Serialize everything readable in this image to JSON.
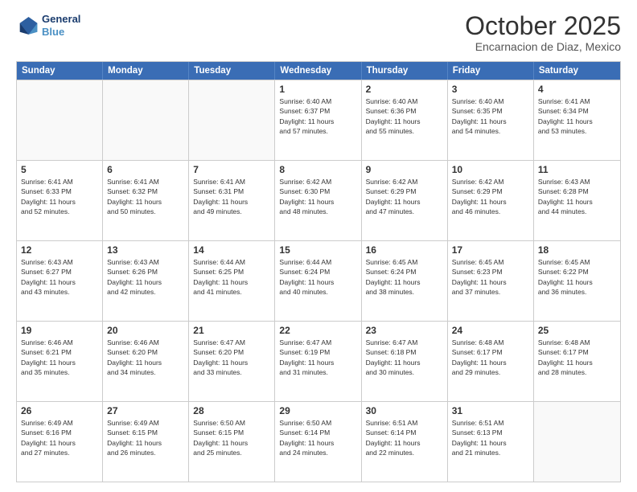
{
  "logo": {
    "line1": "General",
    "line2": "Blue"
  },
  "header": {
    "month": "October 2025",
    "location": "Encarnacion de Diaz, Mexico"
  },
  "days": [
    "Sunday",
    "Monday",
    "Tuesday",
    "Wednesday",
    "Thursday",
    "Friday",
    "Saturday"
  ],
  "weeks": [
    [
      {
        "day": "",
        "info": ""
      },
      {
        "day": "",
        "info": ""
      },
      {
        "day": "",
        "info": ""
      },
      {
        "day": "1",
        "info": "Sunrise: 6:40 AM\nSunset: 6:37 PM\nDaylight: 11 hours\nand 57 minutes."
      },
      {
        "day": "2",
        "info": "Sunrise: 6:40 AM\nSunset: 6:36 PM\nDaylight: 11 hours\nand 55 minutes."
      },
      {
        "day": "3",
        "info": "Sunrise: 6:40 AM\nSunset: 6:35 PM\nDaylight: 11 hours\nand 54 minutes."
      },
      {
        "day": "4",
        "info": "Sunrise: 6:41 AM\nSunset: 6:34 PM\nDaylight: 11 hours\nand 53 minutes."
      }
    ],
    [
      {
        "day": "5",
        "info": "Sunrise: 6:41 AM\nSunset: 6:33 PM\nDaylight: 11 hours\nand 52 minutes."
      },
      {
        "day": "6",
        "info": "Sunrise: 6:41 AM\nSunset: 6:32 PM\nDaylight: 11 hours\nand 50 minutes."
      },
      {
        "day": "7",
        "info": "Sunrise: 6:41 AM\nSunset: 6:31 PM\nDaylight: 11 hours\nand 49 minutes."
      },
      {
        "day": "8",
        "info": "Sunrise: 6:42 AM\nSunset: 6:30 PM\nDaylight: 11 hours\nand 48 minutes."
      },
      {
        "day": "9",
        "info": "Sunrise: 6:42 AM\nSunset: 6:29 PM\nDaylight: 11 hours\nand 47 minutes."
      },
      {
        "day": "10",
        "info": "Sunrise: 6:42 AM\nSunset: 6:29 PM\nDaylight: 11 hours\nand 46 minutes."
      },
      {
        "day": "11",
        "info": "Sunrise: 6:43 AM\nSunset: 6:28 PM\nDaylight: 11 hours\nand 44 minutes."
      }
    ],
    [
      {
        "day": "12",
        "info": "Sunrise: 6:43 AM\nSunset: 6:27 PM\nDaylight: 11 hours\nand 43 minutes."
      },
      {
        "day": "13",
        "info": "Sunrise: 6:43 AM\nSunset: 6:26 PM\nDaylight: 11 hours\nand 42 minutes."
      },
      {
        "day": "14",
        "info": "Sunrise: 6:44 AM\nSunset: 6:25 PM\nDaylight: 11 hours\nand 41 minutes."
      },
      {
        "day": "15",
        "info": "Sunrise: 6:44 AM\nSunset: 6:24 PM\nDaylight: 11 hours\nand 40 minutes."
      },
      {
        "day": "16",
        "info": "Sunrise: 6:45 AM\nSunset: 6:24 PM\nDaylight: 11 hours\nand 38 minutes."
      },
      {
        "day": "17",
        "info": "Sunrise: 6:45 AM\nSunset: 6:23 PM\nDaylight: 11 hours\nand 37 minutes."
      },
      {
        "day": "18",
        "info": "Sunrise: 6:45 AM\nSunset: 6:22 PM\nDaylight: 11 hours\nand 36 minutes."
      }
    ],
    [
      {
        "day": "19",
        "info": "Sunrise: 6:46 AM\nSunset: 6:21 PM\nDaylight: 11 hours\nand 35 minutes."
      },
      {
        "day": "20",
        "info": "Sunrise: 6:46 AM\nSunset: 6:20 PM\nDaylight: 11 hours\nand 34 minutes."
      },
      {
        "day": "21",
        "info": "Sunrise: 6:47 AM\nSunset: 6:20 PM\nDaylight: 11 hours\nand 33 minutes."
      },
      {
        "day": "22",
        "info": "Sunrise: 6:47 AM\nSunset: 6:19 PM\nDaylight: 11 hours\nand 31 minutes."
      },
      {
        "day": "23",
        "info": "Sunrise: 6:47 AM\nSunset: 6:18 PM\nDaylight: 11 hours\nand 30 minutes."
      },
      {
        "day": "24",
        "info": "Sunrise: 6:48 AM\nSunset: 6:17 PM\nDaylight: 11 hours\nand 29 minutes."
      },
      {
        "day": "25",
        "info": "Sunrise: 6:48 AM\nSunset: 6:17 PM\nDaylight: 11 hours\nand 28 minutes."
      }
    ],
    [
      {
        "day": "26",
        "info": "Sunrise: 6:49 AM\nSunset: 6:16 PM\nDaylight: 11 hours\nand 27 minutes."
      },
      {
        "day": "27",
        "info": "Sunrise: 6:49 AM\nSunset: 6:15 PM\nDaylight: 11 hours\nand 26 minutes."
      },
      {
        "day": "28",
        "info": "Sunrise: 6:50 AM\nSunset: 6:15 PM\nDaylight: 11 hours\nand 25 minutes."
      },
      {
        "day": "29",
        "info": "Sunrise: 6:50 AM\nSunset: 6:14 PM\nDaylight: 11 hours\nand 24 minutes."
      },
      {
        "day": "30",
        "info": "Sunrise: 6:51 AM\nSunset: 6:14 PM\nDaylight: 11 hours\nand 22 minutes."
      },
      {
        "day": "31",
        "info": "Sunrise: 6:51 AM\nSunset: 6:13 PM\nDaylight: 11 hours\nand 21 minutes."
      },
      {
        "day": "",
        "info": ""
      }
    ]
  ]
}
